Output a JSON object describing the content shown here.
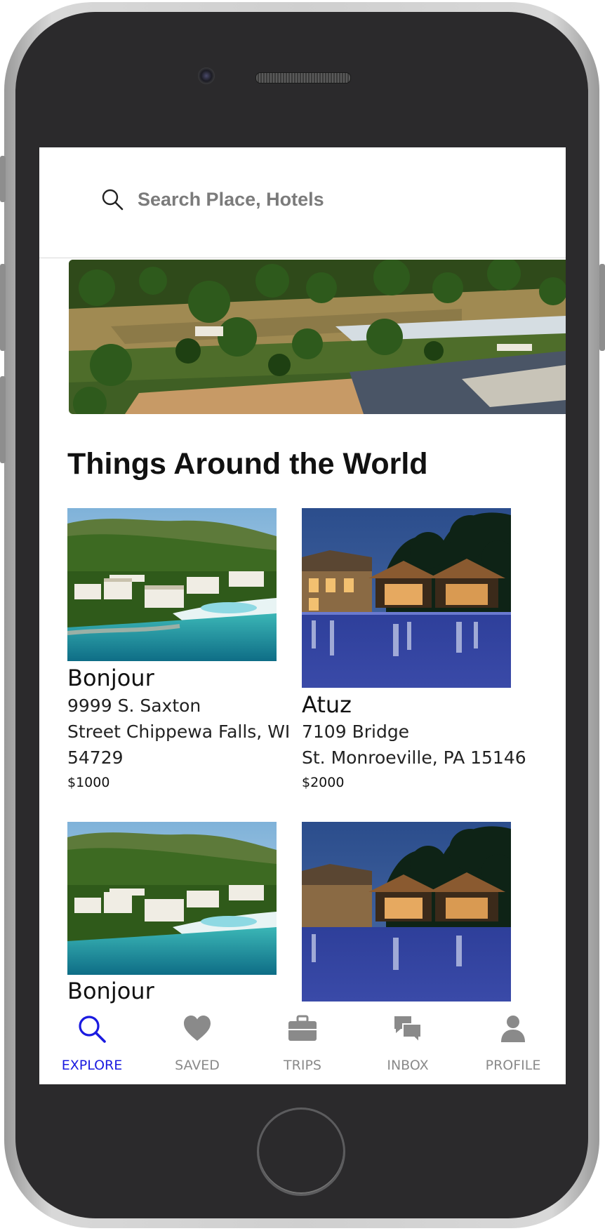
{
  "search": {
    "placeholder": "Search Place, Hotels"
  },
  "main": {
    "section_title": "Things Around the World",
    "cards": [
      {
        "name": "Bonjour",
        "address_line1": "9999 S. Saxton",
        "address_line2": "Street Chippewa Falls, WI",
        "address_line3": "54729",
        "price": "$1000"
      },
      {
        "name": "Atuz",
        "address_line1": "7109 Bridge",
        "address_line2": "St. Monroeville, PA 15146",
        "price": "$2000"
      },
      {
        "name": "Bonjour"
      }
    ]
  },
  "tabbar": {
    "tabs": [
      {
        "label": "EXPLORE",
        "icon": "search-icon",
        "active": true
      },
      {
        "label": "SAVED",
        "icon": "heart-icon"
      },
      {
        "label": "TRIPS",
        "icon": "briefcase-icon"
      },
      {
        "label": "INBOX",
        "icon": "chat-bubbles-icon"
      },
      {
        "label": "PROFILE",
        "icon": "person-icon"
      }
    ]
  },
  "colors": {
    "accent": "#1a1ae0",
    "inactive": "#8a8a8a",
    "phone_body": "#2b2a2c"
  }
}
